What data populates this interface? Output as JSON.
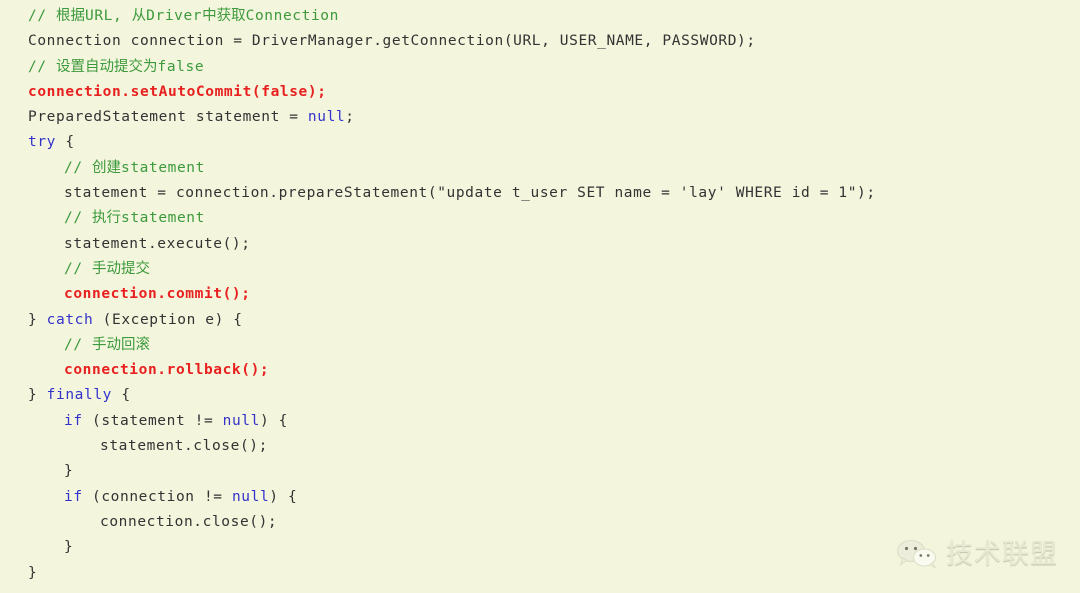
{
  "editor": {
    "language": "java",
    "background_color": "#f4f5dd",
    "colors": {
      "plain": "#333333",
      "comment": "#3c9a3c",
      "keyword": "#3333cc",
      "emphasis_red": "#e8201f"
    },
    "lines": [
      {
        "indent": 0,
        "tokens": [
          {
            "kind": "comment",
            "text": "// "
          },
          {
            "kind": "comment",
            "cjk": true,
            "text": "根据"
          },
          {
            "kind": "comment",
            "text": "URL, "
          },
          {
            "kind": "comment",
            "cjk": true,
            "text": "从"
          },
          {
            "kind": "comment",
            "text": "Driver"
          },
          {
            "kind": "comment",
            "cjk": true,
            "text": "中获取"
          },
          {
            "kind": "comment",
            "text": "Connection"
          }
        ]
      },
      {
        "indent": 0,
        "tokens": [
          {
            "kind": "plain",
            "text": "Connection connection = DriverManager.getConnection(URL, USER_NAME, PASSWORD);"
          }
        ]
      },
      {
        "indent": 0,
        "tokens": [
          {
            "kind": "comment",
            "text": "// "
          },
          {
            "kind": "comment",
            "cjk": true,
            "text": "设置自动提交为"
          },
          {
            "kind": "comment",
            "text": "false"
          }
        ]
      },
      {
        "indent": 0,
        "tokens": [
          {
            "kind": "emph",
            "text": "connection.setAutoCommit(false);"
          }
        ]
      },
      {
        "indent": 0,
        "tokens": [
          {
            "kind": "plain",
            "text": "PreparedStatement statement = "
          },
          {
            "kind": "keyword",
            "text": "null"
          },
          {
            "kind": "plain",
            "text": ";"
          }
        ]
      },
      {
        "indent": 0,
        "tokens": [
          {
            "kind": "keyword",
            "text": "try"
          },
          {
            "kind": "plain",
            "text": " {"
          }
        ]
      },
      {
        "indent": 1,
        "tokens": [
          {
            "kind": "comment",
            "text": "// "
          },
          {
            "kind": "comment",
            "cjk": true,
            "text": "创建"
          },
          {
            "kind": "comment",
            "text": "statement"
          }
        ]
      },
      {
        "indent": 1,
        "tokens": [
          {
            "kind": "plain",
            "text": "statement = connection.prepareStatement(\"update t_user SET name = 'lay' WHERE id = 1\");"
          }
        ]
      },
      {
        "indent": 1,
        "tokens": [
          {
            "kind": "comment",
            "text": "// "
          },
          {
            "kind": "comment",
            "cjk": true,
            "text": "执行"
          },
          {
            "kind": "comment",
            "text": "statement"
          }
        ]
      },
      {
        "indent": 1,
        "tokens": [
          {
            "kind": "plain",
            "text": "statement.execute();"
          }
        ]
      },
      {
        "indent": 1,
        "tokens": [
          {
            "kind": "comment",
            "text": "// "
          },
          {
            "kind": "comment",
            "cjk": true,
            "text": "手动提交"
          }
        ]
      },
      {
        "indent": 1,
        "tokens": [
          {
            "kind": "emph",
            "text": "connection.commit();"
          }
        ]
      },
      {
        "indent": 0,
        "tokens": [
          {
            "kind": "plain",
            "text": "} "
          },
          {
            "kind": "keyword",
            "text": "catch"
          },
          {
            "kind": "plain",
            "text": " (Exception e) {"
          }
        ]
      },
      {
        "indent": 1,
        "tokens": [
          {
            "kind": "comment",
            "text": "// "
          },
          {
            "kind": "comment",
            "cjk": true,
            "text": "手动回滚"
          }
        ]
      },
      {
        "indent": 1,
        "tokens": [
          {
            "kind": "emph",
            "text": "connection.rollback();"
          }
        ]
      },
      {
        "indent": 0,
        "tokens": [
          {
            "kind": "plain",
            "text": "} "
          },
          {
            "kind": "keyword",
            "text": "finally"
          },
          {
            "kind": "plain",
            "text": " {"
          }
        ]
      },
      {
        "indent": 1,
        "tokens": [
          {
            "kind": "keyword",
            "text": "if"
          },
          {
            "kind": "plain",
            "text": " (statement != "
          },
          {
            "kind": "keyword",
            "text": "null"
          },
          {
            "kind": "plain",
            "text": ") {"
          }
        ]
      },
      {
        "indent": 2,
        "tokens": [
          {
            "kind": "plain",
            "text": "statement.close();"
          }
        ]
      },
      {
        "indent": 1,
        "tokens": [
          {
            "kind": "plain",
            "text": "}"
          }
        ]
      },
      {
        "indent": 1,
        "tokens": [
          {
            "kind": "keyword",
            "text": "if"
          },
          {
            "kind": "plain",
            "text": " (connection != "
          },
          {
            "kind": "keyword",
            "text": "null"
          },
          {
            "kind": "plain",
            "text": ") {"
          }
        ]
      },
      {
        "indent": 2,
        "tokens": [
          {
            "kind": "plain",
            "text": "connection.close();"
          }
        ]
      },
      {
        "indent": 1,
        "tokens": [
          {
            "kind": "plain",
            "text": "}"
          }
        ]
      },
      {
        "indent": 0,
        "tokens": [
          {
            "kind": "plain",
            "text": "}"
          }
        ]
      }
    ]
  },
  "watermark": {
    "icon": "wechat-logo-icon",
    "text": "技术联盟",
    "text_color": "#e7e8d2"
  }
}
